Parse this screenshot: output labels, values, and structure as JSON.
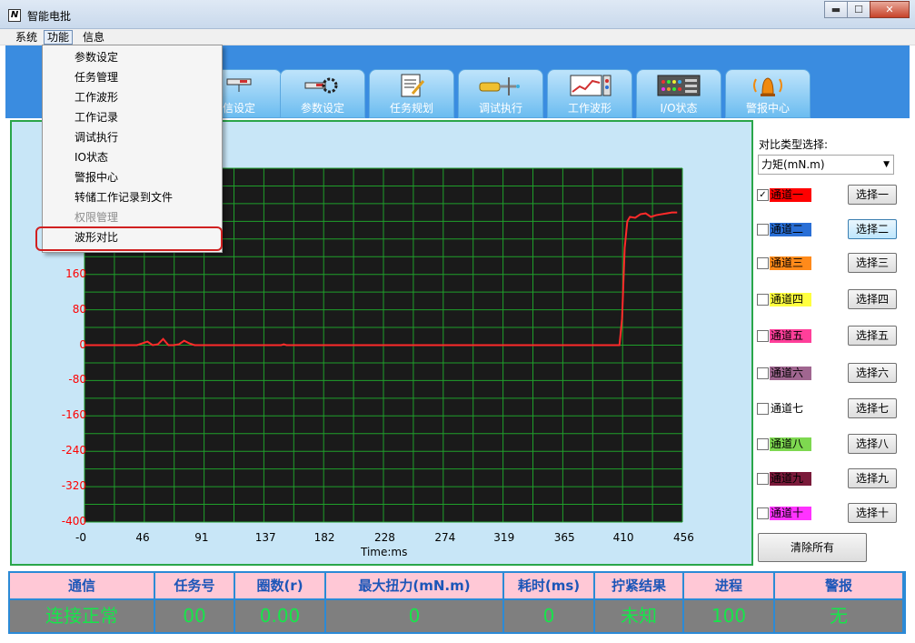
{
  "window": {
    "title": "智能电批",
    "icon_text": "N",
    "min_label": "▬",
    "max_label": "☐",
    "close_label": "✕"
  },
  "menubar": {
    "items": [
      "系统",
      "功能",
      "信息"
    ]
  },
  "dropdown": {
    "items": [
      {
        "label": "参数设定",
        "enabled": true
      },
      {
        "label": "任务管理",
        "enabled": true
      },
      {
        "label": "工作波形",
        "enabled": true
      },
      {
        "label": "工作记录",
        "enabled": true
      },
      {
        "label": "调试执行",
        "enabled": true
      },
      {
        "label": "IO状态",
        "enabled": true
      },
      {
        "label": "警报中心",
        "enabled": true
      },
      {
        "label": "转储工作记录到文件",
        "enabled": true
      },
      {
        "label": "权限管理",
        "enabled": false
      },
      {
        "label": "波形对比",
        "enabled": true,
        "highlighted": true
      }
    ]
  },
  "toolbar": {
    "tabs": [
      {
        "label": "信设定",
        "icon": "comm-settings-icon"
      },
      {
        "label": "参数设定",
        "icon": "gear-settings-icon"
      },
      {
        "label": "任务规划",
        "icon": "task-plan-icon"
      },
      {
        "label": "调试执行",
        "icon": "screwdriver-icon"
      },
      {
        "label": "工作波形",
        "icon": "waveform-chart-icon"
      },
      {
        "label": "I/O状态",
        "icon": "io-panel-icon"
      },
      {
        "label": "警报中心",
        "icon": "alarm-bell-icon"
      }
    ]
  },
  "chart_data": {
    "type": "line",
    "xlabel": "Time:ms",
    "ylabel": "",
    "x_ticks": [
      "-0",
      "46",
      "91",
      "137",
      "182",
      "228",
      "274",
      "319",
      "365",
      "410",
      "456"
    ],
    "y_ticks_visible": [
      "160",
      "80",
      "0",
      "-80",
      "-160",
      "-240",
      "-320",
      "-400"
    ],
    "xlim": [
      0,
      456
    ],
    "ylim": [
      -400,
      400
    ],
    "grid": true,
    "background": "#1a1a1a",
    "grid_color": "#1f9f2a",
    "series": [
      {
        "color": "#ff2a2a",
        "x": [
          0,
          40,
          44,
          48,
          52,
          56,
          60,
          64,
          68,
          72,
          76,
          80,
          84,
          88,
          150,
          152,
          154,
          300,
          408,
          410,
          412,
          414,
          416,
          420,
          424,
          428,
          432,
          436,
          440,
          444,
          448,
          452
        ],
        "y": [
          0,
          0,
          4,
          8,
          0,
          2,
          14,
          0,
          0,
          2,
          10,
          4,
          0,
          0,
          0,
          2,
          0,
          0,
          0,
          60,
          220,
          280,
          290,
          288,
          296,
          298,
          290,
          294,
          296,
          298,
          300,
          300
        ]
      }
    ]
  },
  "right_panel": {
    "compare_label": "对比类型选择:",
    "compare_value": "力矩(mN.m)",
    "channels": [
      {
        "label": "通道一",
        "color": "#ff0000",
        "text_color": "#000000",
        "checked": true,
        "button": "选择一",
        "focused": false
      },
      {
        "label": "通道二",
        "color": "#2a6fd6",
        "text_color": "#000000",
        "checked": false,
        "button": "选择二",
        "focused": true
      },
      {
        "label": "通道三",
        "color": "#ff8a1a",
        "text_color": "#000000",
        "checked": false,
        "button": "选择三",
        "focused": false
      },
      {
        "label": "通道四",
        "color": "#ffff40",
        "text_color": "#000000",
        "checked": false,
        "button": "选择四",
        "focused": false
      },
      {
        "label": "通道五",
        "color": "#ff3f9a",
        "text_color": "#000000",
        "checked": false,
        "button": "选择五",
        "focused": false
      },
      {
        "label": "通道六",
        "color": "#a06690",
        "text_color": "#000000",
        "checked": false,
        "button": "选择六",
        "focused": false
      },
      {
        "label": "通道七",
        "color": "#ffffff",
        "text_color": "#000000",
        "checked": false,
        "button": "选择七",
        "focused": false
      },
      {
        "label": "通道八",
        "color": "#7ed850",
        "text_color": "#000000",
        "checked": false,
        "button": "选择八",
        "focused": false
      },
      {
        "label": "通道九",
        "color": "#7a1a3a",
        "text_color": "#000000",
        "checked": false,
        "button": "选择九",
        "focused": false
      },
      {
        "label": "通道十",
        "color": "#ff33ff",
        "text_color": "#000000",
        "checked": false,
        "button": "选择十",
        "focused": false
      }
    ],
    "clear_label": "清除所有"
  },
  "status": {
    "columns": [
      {
        "head": "通信",
        "value": "连接正常"
      },
      {
        "head": "任务号",
        "value": "00"
      },
      {
        "head": "圈数(r)",
        "value": "0.00"
      },
      {
        "head": "最大扭力(mN.m)",
        "value": "0"
      },
      {
        "head": "耗时(ms)",
        "value": "0"
      },
      {
        "head": "拧紧结果",
        "value": "未知"
      },
      {
        "head": "进程",
        "value": "100"
      },
      {
        "head": "警报",
        "value": "无"
      }
    ]
  }
}
